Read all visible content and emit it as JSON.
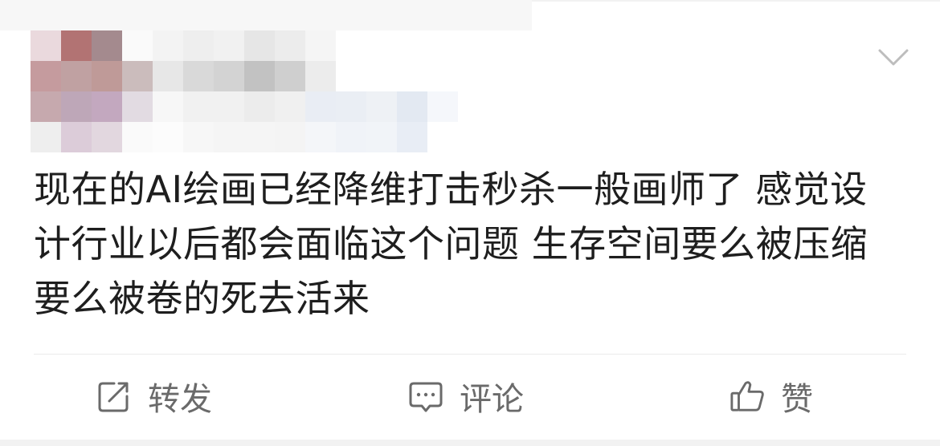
{
  "post": {
    "text": "现在的AI绘画已经降维打击秒杀一般画师了 感觉设计行业以后都会面临这个问题 生存空间要么被压缩要么被卷的死去活来"
  },
  "header": {
    "avatar_blurred": true,
    "more_icon": "chevron-down-icon"
  },
  "actions": {
    "repost_label": "转发",
    "comment_label": "评论",
    "like_label": "赞",
    "repost_icon": "share-icon",
    "comment_icon": "comment-icon",
    "like_icon": "thumbs-up-icon"
  },
  "colors": {
    "text": "#1e1e1e",
    "action_text": "#6a6a6a",
    "divider": "#ebebeb"
  }
}
